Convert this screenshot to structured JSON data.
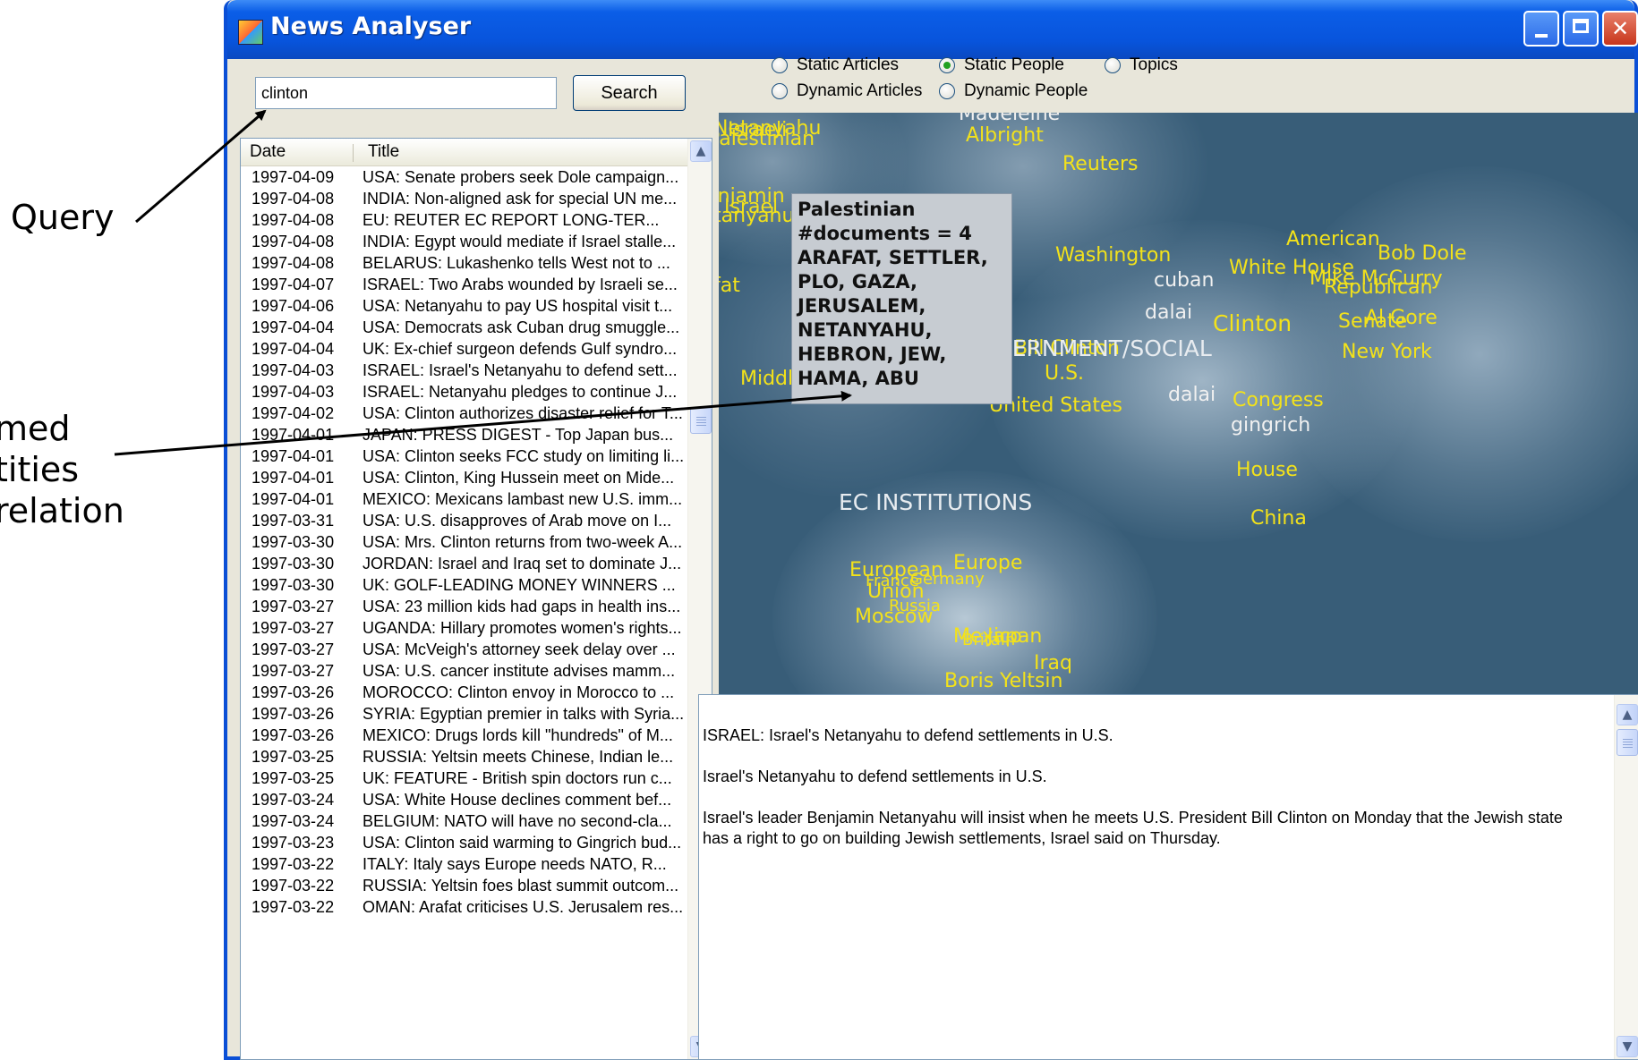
{
  "annotations": {
    "query": "Query",
    "named_entities": [
      "med",
      "tities",
      "relation"
    ]
  },
  "window": {
    "title": "News Analyser"
  },
  "search": {
    "value": "clinton",
    "button_label": "Search"
  },
  "view_options": [
    {
      "label": "Static Articles",
      "selected": false
    },
    {
      "label": "Static People",
      "selected": true
    },
    {
      "label": "Topics",
      "selected": false
    },
    {
      "label": "Dynamic Articles",
      "selected": false
    },
    {
      "label": "Dynamic People",
      "selected": false
    }
  ],
  "list": {
    "headers": {
      "date": "Date",
      "title": "Title"
    },
    "rows": [
      {
        "date": "1997-04-09",
        "title": "USA: Senate probers seek Dole campaign..."
      },
      {
        "date": "1997-04-08",
        "title": "INDIA: Non-aligned ask for special UN me..."
      },
      {
        "date": "1997-04-08",
        "title": "EU:  REUTER EC REPORT LONG-TER..."
      },
      {
        "date": "1997-04-08",
        "title": "INDIA: Egypt would mediate if Israel stalle..."
      },
      {
        "date": "1997-04-08",
        "title": "BELARUS: Lukashenko tells West not to ..."
      },
      {
        "date": "1997-04-07",
        "title": "ISRAEL: Two Arabs wounded by Israeli se..."
      },
      {
        "date": "1997-04-06",
        "title": "USA: Netanyahu to pay US hospital visit t..."
      },
      {
        "date": "1997-04-04",
        "title": "USA: Democrats ask Cuban drug smuggle..."
      },
      {
        "date": "1997-04-04",
        "title": "UK: Ex-chief surgeon defends Gulf syndro..."
      },
      {
        "date": "1997-04-03",
        "title": "ISRAEL: Israel's Netanyahu to defend sett..."
      },
      {
        "date": "1997-04-03",
        "title": "ISRAEL: Netanyahu pledges to continue J..."
      },
      {
        "date": "1997-04-02",
        "title": "USA: Clinton authorizes disaster relief for T..."
      },
      {
        "date": "1997-04-01",
        "title": "JAPAN: PRESS DIGEST - Top Japan bus..."
      },
      {
        "date": "1997-04-01",
        "title": "USA: Clinton seeks FCC study on limiting li..."
      },
      {
        "date": "1997-04-01",
        "title": "USA: Clinton, King Hussein meet on Mide..."
      },
      {
        "date": "1997-04-01",
        "title": "MEXICO: Mexicans lambast new U.S. imm..."
      },
      {
        "date": "1997-03-31",
        "title": "USA: U.S. disapproves of Arab move on I..."
      },
      {
        "date": "1997-03-30",
        "title": "USA: Mrs. Clinton returns from two-week A..."
      },
      {
        "date": "1997-03-30",
        "title": "JORDAN: Israel and Iraq set to dominate J..."
      },
      {
        "date": "1997-03-30",
        "title": "UK: GOLF-LEADING MONEY WINNERS ..."
      },
      {
        "date": "1997-03-27",
        "title": "USA: 23 million kids had gaps in health ins..."
      },
      {
        "date": "1997-03-27",
        "title": "UGANDA: Hillary promotes women's rights..."
      },
      {
        "date": "1997-03-27",
        "title": "USA: McVeigh's attorney seek delay over ..."
      },
      {
        "date": "1997-03-27",
        "title": "USA: U.S. cancer institute advises mamm..."
      },
      {
        "date": "1997-03-26",
        "title": "MOROCCO: Clinton envoy in Morocco to ..."
      },
      {
        "date": "1997-03-26",
        "title": "SYRIA: Egyptian premier in talks with Syria..."
      },
      {
        "date": "1997-03-26",
        "title": "MEXICO: Drugs lords kill \"hundreds\" of M..."
      },
      {
        "date": "1997-03-25",
        "title": "RUSSIA: Yeltsin meets Chinese, Indian le..."
      },
      {
        "date": "1997-03-25",
        "title": "UK: FEATURE - British spin doctors run c..."
      },
      {
        "date": "1997-03-24",
        "title": "USA: White House declines comment bef..."
      },
      {
        "date": "1997-03-24",
        "title": "BELGIUM: NATO will have no second-cla..."
      },
      {
        "date": "1997-03-23",
        "title": "USA: Clinton said warming to Gingrich bud..."
      },
      {
        "date": "1997-03-22",
        "title": "ITALY: Italy says Europe needs NATO, R..."
      },
      {
        "date": "1997-03-22",
        "title": "RUSSIA: Yeltsin foes blast summit outcom..."
      },
      {
        "date": "1997-03-22",
        "title": "OMAN: Arafat criticises U.S. Jerusalem res..."
      }
    ]
  },
  "map": {
    "colors": {
      "background": "#385d78",
      "entity": "#f3e21a",
      "term": "#f0f0f0"
    },
    "labels": {
      "madeleine": "Madeleine",
      "albright": "Albright",
      "netanyahu_top": "Netanyahu",
      "palestinian": "Palestinian",
      "israeli": "Israeli",
      "reuters": "Reuters",
      "benjamin": "Benjamin",
      "netanyahu_mid": "Netanyahu",
      "israel": "Israel",
      "washington": "Washington",
      "american": "American",
      "bob_dole": "Bob Dole",
      "cuban": "cuban",
      "white_house": "White House",
      "mike_mccurry": "Mike McCurry",
      "republican": "Republican",
      "arafat": "Yasser Arafat",
      "dalai_1": "dalai",
      "clinton": "Clinton",
      "senate": "Senate",
      "al_gore": "Al Gore",
      "bill_clinton": "Bill Clinton",
      "us": "U.S.",
      "new_york": "New York",
      "middle": "Middle",
      "dalai_2": "dalai",
      "united_states": "United States",
      "congress": "Congress",
      "gingrich": "gingrich",
      "house": "House",
      "china": "China",
      "europe": "Europe",
      "european": "European",
      "european_union": "European",
      "union": "Union",
      "france": "France",
      "russia": "Russia",
      "germany": "Germany",
      "moscow": "Moscow",
      "mexico": "Mexico",
      "japan": "Japan",
      "britain": "Britain",
      "iraq": "Iraq",
      "boris_yeltsin": "Boris Yeltsin"
    },
    "categories": {
      "gov_social": "GOVERNMENT/SOCIAL",
      "ec_institutions": "EC INSTITUTIONS"
    },
    "tooltip": {
      "lines": [
        "Palestinian",
        "#documents = 4",
        "ARAFAT, SETTLER,",
        "PLO, GAZA,",
        "JERUSALEM,",
        "NETANYAHU,",
        "HEBRON, JEW,",
        "HAMA, ABU"
      ]
    }
  },
  "detail": {
    "paragraphs": [
      "ISRAEL: Israel's Netanyahu to defend settlements in U.S.",
      "Israel's Netanyahu to defend settlements in U.S.",
      "Israel's leader Benjamin Netanyahu will insist when he meets U.S. President Bill Clinton on Monday that the Jewish state has a right to go on building Jewish settlements, Israel said on Thursday."
    ]
  }
}
